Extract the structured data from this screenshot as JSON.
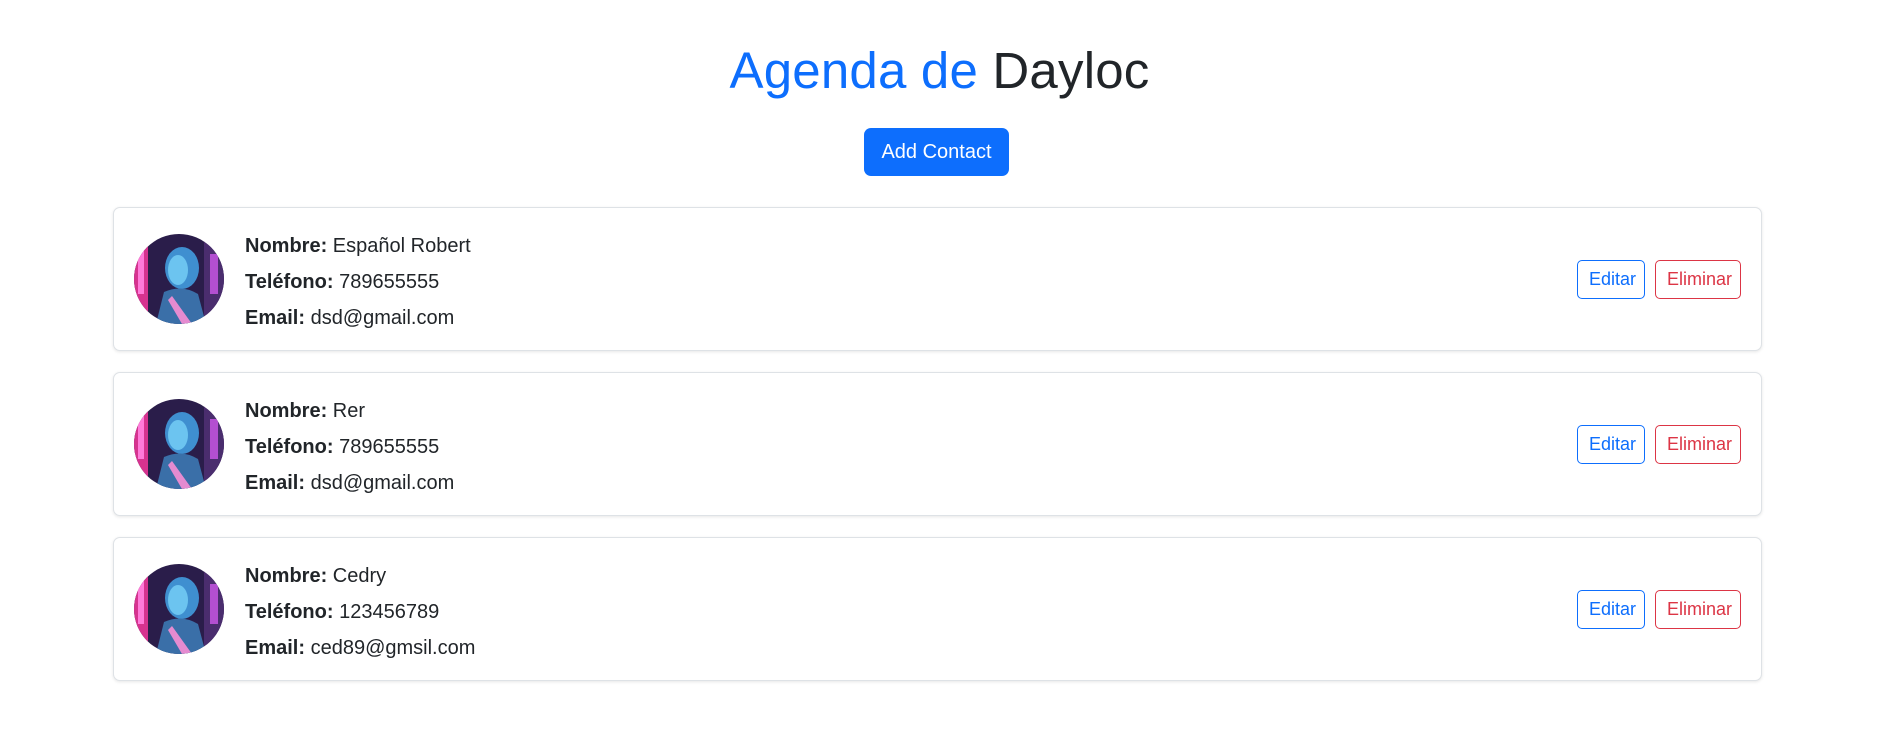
{
  "header": {
    "title_accent": "Agenda de",
    "title_rest": "Dayloc",
    "add_button_label": "Add Contact"
  },
  "labels": {
    "name": "Nombre:",
    "phone": "Teléfono:",
    "email": "Email:",
    "edit": "Editar",
    "delete": "Eliminar"
  },
  "contacts": [
    {
      "name": "Español Robert",
      "phone": "789655555",
      "email": "dsd@gmail.com"
    },
    {
      "name": "Rer",
      "phone": "789655555",
      "email": "dsd@gmail.com"
    },
    {
      "name": "Cedry",
      "phone": "123456789",
      "email": "ced89@gmsil.com"
    }
  ],
  "colors": {
    "primary": "#0d6efd",
    "danger": "#dc3545",
    "text": "#212529",
    "border": "#dee2e6"
  }
}
